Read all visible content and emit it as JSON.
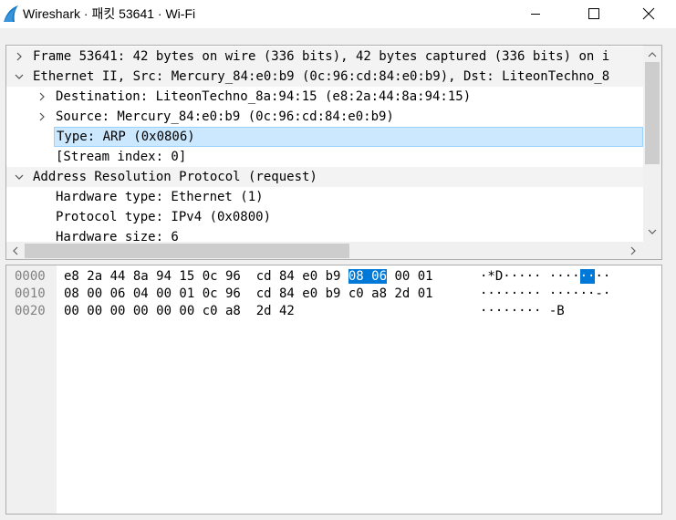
{
  "window": {
    "title": "Wireshark · 패킷 53641 · Wi-Fi",
    "icon": "wireshark-fin-icon",
    "controls": [
      "minimize-icon",
      "maximize-icon",
      "close-icon"
    ]
  },
  "details": {
    "rows": [
      {
        "indent": 0,
        "toggle": "collapsed",
        "text": "Frame 53641: 42 bytes on wire (336 bits), 42 bytes captured (336 bits) on i"
      },
      {
        "indent": 0,
        "toggle": "expanded",
        "text": "Ethernet II, Src: Mercury_84:e0:b9 (0c:96:cd:84:e0:b9), Dst: LiteonTechno_8"
      },
      {
        "indent": 1,
        "toggle": "collapsed",
        "text": "Destination: LiteonTechno_8a:94:15 (e8:2a:44:8a:94:15)"
      },
      {
        "indent": 1,
        "toggle": "collapsed",
        "text": "Source: Mercury_84:e0:b9 (0c:96:cd:84:e0:b9)"
      },
      {
        "indent": 1,
        "toggle": "none",
        "text": "Type: ARP (0x0806)",
        "selected": true
      },
      {
        "indent": 1,
        "toggle": "none",
        "text": "[Stream index: 0]"
      },
      {
        "indent": 0,
        "toggle": "expanded",
        "text": "Address Resolution Protocol (request)"
      },
      {
        "indent": 1,
        "toggle": "none",
        "text": "Hardware type: Ethernet (1)"
      },
      {
        "indent": 1,
        "toggle": "none",
        "text": "Protocol type: IPv4 (0x0800)"
      },
      {
        "indent": 1,
        "toggle": "none",
        "text": "Hardware size: 6"
      }
    ]
  },
  "hex": {
    "lines": [
      {
        "offset": "0000",
        "hex_before": "e8 2a 44 8a 94 15 0c 96  cd 84 e0 b9 ",
        "hex_sel": "08 06",
        "hex_after": " 00 01",
        "ascii_before": "·*D····· ····",
        "ascii_sel": "··",
        "ascii_after": "··"
      },
      {
        "offset": "0010",
        "hex": "08 00 06 04 00 01 0c 96  cd 84 e0 b9 c0 a8 2d 01",
        "ascii": "········ ······-·"
      },
      {
        "offset": "0020",
        "hex": "00 00 00 00 00 00 c0 a8  2d 42",
        "ascii": "········ -B"
      }
    ]
  }
}
